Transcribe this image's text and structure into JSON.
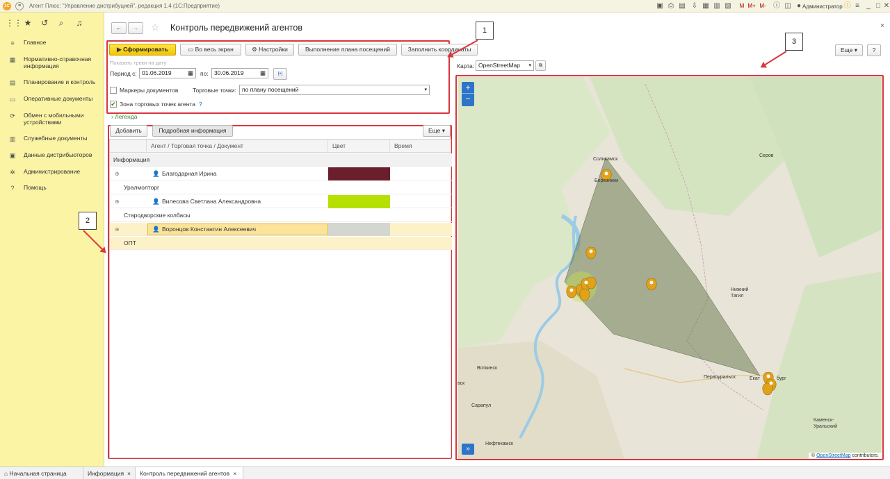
{
  "titlebar": {
    "text": "Агент Плюс: \"Управление дистрибуцией\", редакция 1.4  (1С:Предприятие)",
    "user": "Администратор",
    "zoom_labels": [
      "M",
      "M+",
      "M-"
    ]
  },
  "nav": {
    "items": [
      {
        "label": "Главное",
        "icon": "menu-icon"
      },
      {
        "label": "Нормативно-справочная информация",
        "icon": "catalog-icon"
      },
      {
        "label": "Планирование и контроль",
        "icon": "planning-icon"
      },
      {
        "label": "Оперативные документы",
        "icon": "documents-icon"
      },
      {
        "label": "Обмен с мобильными устройствами",
        "icon": "sync-icon"
      },
      {
        "label": "Служебные документы",
        "icon": "service-docs-icon"
      },
      {
        "label": "Данные дистрибьюторов",
        "icon": "distributors-icon"
      },
      {
        "label": "Администрирование",
        "icon": "gear-icon"
      },
      {
        "label": "Помощь",
        "icon": "help-icon"
      }
    ]
  },
  "page": {
    "title": "Контроль передвижений агентов",
    "more": "Еще",
    "help": "?"
  },
  "toolbar": {
    "generate": "Сформировать",
    "fullscreen": "Во весь экран",
    "settings": "Настройки",
    "plan": "Выполнение плана посещений",
    "fill": "Заполнить координаты"
  },
  "filters": {
    "show_tracks": "Показать треки на дату",
    "period_label": "Период с:",
    "date_from": "01.06.2019",
    "to_label": "по:",
    "date_to": "30.06.2019",
    "doc_markers": "Маркеры документов",
    "outlets_label": "Торговые точки:",
    "outlets_value": "по плану посещений",
    "zone": "Зона торговых точек агента",
    "zone_help": "?",
    "legend": "Легенда"
  },
  "table": {
    "add": "Добавить",
    "details": "Подробная информация",
    "more": "Еще",
    "columns": [
      "Агент / Торговая точка / Документ",
      "Цвет",
      "Время"
    ],
    "group": "Информация",
    "rows": [
      {
        "agent": "Благодарная Ирина",
        "color": "#6b1e2b",
        "outlet": "Уралмолторг"
      },
      {
        "agent": "Вилесова Светлана Александровна",
        "color": "#b6e000",
        "outlet": "Стародворские колбасы"
      },
      {
        "agent": "Воронцов Константин Алексеевич",
        "color": "#d4d6d0",
        "outlet": "ОПТ"
      }
    ]
  },
  "map": {
    "label": "Карта:",
    "provider": "OpenStreetMap",
    "zoom_in": "+",
    "zoom_out": "−",
    "expand": "»",
    "attribution_prefix": "©",
    "attribution_link": "OpenStreetMap",
    "attribution_suffix": "contributors.",
    "cities": [
      "Соликамск",
      "Березники",
      "Серов",
      "Нижний Тагил",
      "Первоуральск",
      "Екатеринбург",
      "Каменск-Уральский",
      "Воткинск",
      "Сарапул",
      "Нефтекамск",
      "Ижевск"
    ],
    "city_fragments": {
      "ekb_left": "Екат",
      "ekb_right": "бург",
      "izhevsk": "вск"
    }
  },
  "callouts": [
    "1",
    "2",
    "3"
  ],
  "tabs": [
    "Начальная страница",
    "Информация",
    "Контроль передвижений агентов"
  ],
  "colors": {
    "accent_red": "#d9363e",
    "yellow_panel": "#fbf4a5",
    "generate_button": "#f2c400",
    "zone_fill": "#6e7d55"
  }
}
